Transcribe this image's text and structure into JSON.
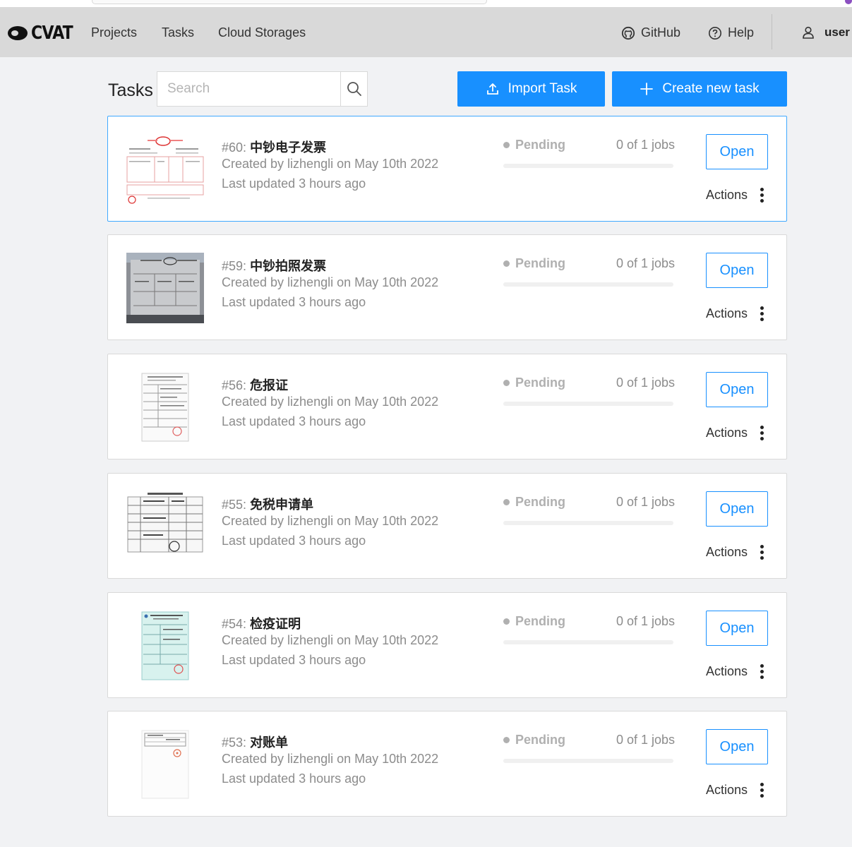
{
  "header": {
    "logo_text": "CVAT",
    "nav": [
      {
        "label": "Projects"
      },
      {
        "label": "Tasks"
      },
      {
        "label": "Cloud Storages"
      }
    ],
    "github_label": "GitHub",
    "help_label": "Help",
    "user_label": "user"
  },
  "toolbar": {
    "title": "Tasks",
    "search_placeholder": "Search",
    "import_label": "Import Task",
    "create_label": "Create new task"
  },
  "tasks": [
    {
      "id": "#60:",
      "name": "中钞电子发票",
      "created": "Created by lizhengli on May 10th 2022",
      "updated": "Last updated 3 hours ago",
      "status": "Pending",
      "jobs": "0 of 1 jobs",
      "progress": 0,
      "open_label": "Open",
      "actions_label": "Actions"
    },
    {
      "id": "#59:",
      "name": "中钞拍照发票",
      "created": "Created by lizhengli on May 10th 2022",
      "updated": "Last updated 3 hours ago",
      "status": "Pending",
      "jobs": "0 of 1 jobs",
      "progress": 0,
      "open_label": "Open",
      "actions_label": "Actions"
    },
    {
      "id": "#56:",
      "name": "危报证",
      "created": "Created by lizhengli on May 10th 2022",
      "updated": "Last updated 3 hours ago",
      "status": "Pending",
      "jobs": "0 of 1 jobs",
      "progress": 0,
      "open_label": "Open",
      "actions_label": "Actions"
    },
    {
      "id": "#55:",
      "name": "免税申请单",
      "created": "Created by lizhengli on May 10th 2022",
      "updated": "Last updated 3 hours ago",
      "status": "Pending",
      "jobs": "0 of 1 jobs",
      "progress": 0,
      "open_label": "Open",
      "actions_label": "Actions"
    },
    {
      "id": "#54:",
      "name": "检疫证明",
      "created": "Created by lizhengli on May 10th 2022",
      "updated": "Last updated 3 hours ago",
      "status": "Pending",
      "jobs": "0 of 1 jobs",
      "progress": 0,
      "open_label": "Open",
      "actions_label": "Actions"
    },
    {
      "id": "#53:",
      "name": "对账单",
      "created": "Created by lizhengli on May 10th 2022",
      "updated": "Last updated 3 hours ago",
      "status": "Pending",
      "jobs": "0 of 1 jobs",
      "progress": 0,
      "open_label": "Open",
      "actions_label": "Actions"
    }
  ],
  "colors": {
    "accent": "#1890ff",
    "header_bg": "#d9d9d9",
    "page_bg": "#f1f2f4",
    "status_pending": "#b0b0b0"
  }
}
